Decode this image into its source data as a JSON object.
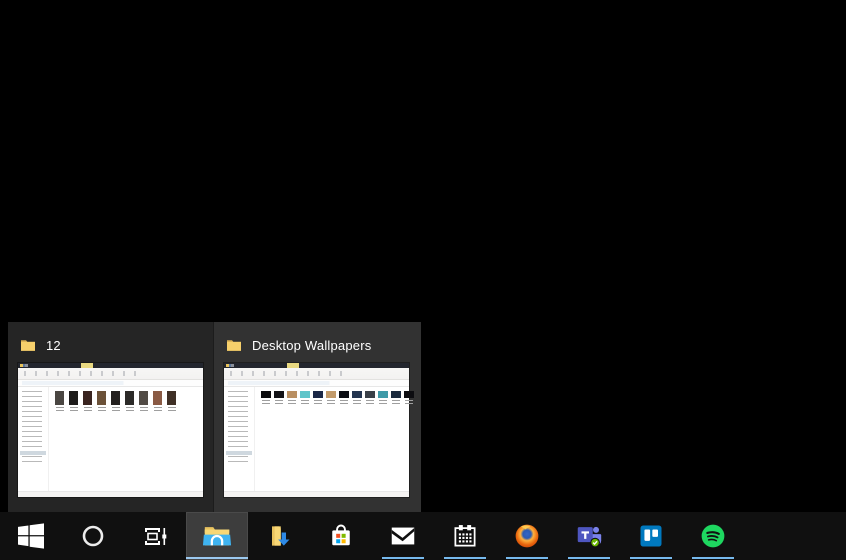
{
  "desktop": {
    "background_color": "#000000"
  },
  "preview_flyout": {
    "background_color": "#252525",
    "hover_background_color": "#323232",
    "items": [
      {
        "title": "12",
        "icon": "folder-icon",
        "hovered": false,
        "thumbnails": {
          "orientation": "portrait",
          "colors": [
            "#4a4642",
            "#1d1b1a",
            "#3a2420",
            "#6b5138",
            "#23201e",
            "#2c2a28",
            "#514b45",
            "#8a5a44",
            "#3f3026"
          ]
        }
      },
      {
        "title": "Desktop Wallpapers",
        "icon": "folder-icon",
        "hovered": true,
        "thumbnails": {
          "orientation": "landscape",
          "colors": [
            "#0b0b0d",
            "#121216",
            "#b98f62",
            "#5fc4c9",
            "#1a2746",
            "#c29a6a",
            "#0a0c12",
            "#23344f",
            "#3a4048",
            "#3f9aa8",
            "#1b2a3e",
            "#0c0c10"
          ]
        }
      }
    ]
  },
  "taskbar": {
    "background_color": "#101010",
    "accent_underline_color": "#76b9ed",
    "active_button_background": "#3d3d3d",
    "buttons": [
      {
        "icon": "start-icon",
        "running": false,
        "active": false
      },
      {
        "icon": "cortana-icon",
        "running": false,
        "active": false
      },
      {
        "icon": "task-view-icon",
        "running": false,
        "active": false
      },
      {
        "icon": "file-explorer-icon",
        "running": true,
        "active": true
      },
      {
        "icon": "downloads-folder-icon",
        "running": false,
        "active": false
      },
      {
        "icon": "microsoft-store-icon",
        "running": false,
        "active": false
      },
      {
        "icon": "mail-icon",
        "running": true,
        "active": false
      },
      {
        "icon": "calendar-icon",
        "running": true,
        "active": false
      },
      {
        "icon": "firefox-icon",
        "running": true,
        "active": false
      },
      {
        "icon": "teams-icon",
        "running": true,
        "active": false
      },
      {
        "icon": "trello-icon",
        "running": true,
        "active": false
      },
      {
        "icon": "spotify-icon",
        "running": true,
        "active": false
      }
    ]
  }
}
